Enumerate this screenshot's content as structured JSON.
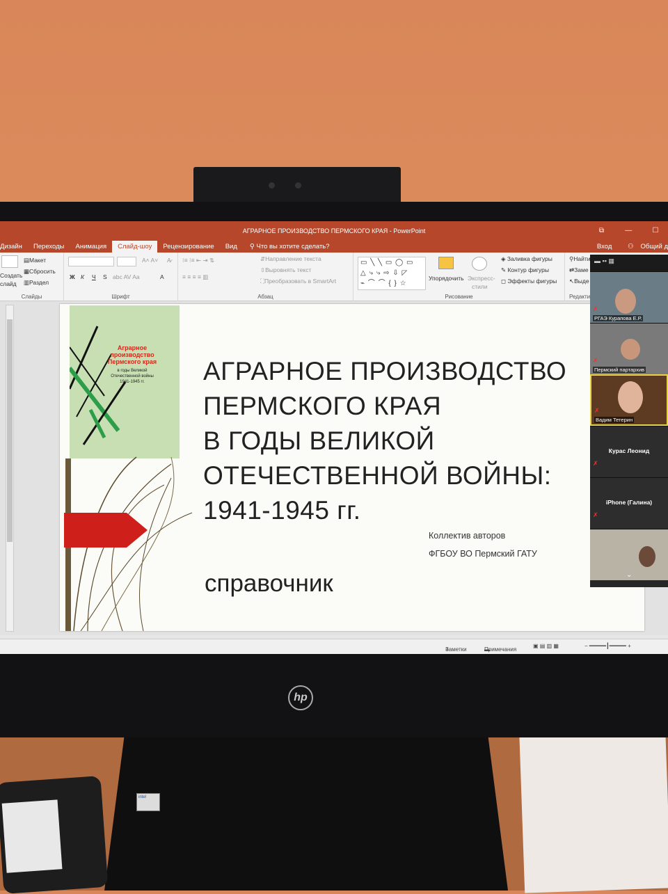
{
  "window": {
    "title": "АГРАРНОЕ ПРОИЗВОДСТВО ПЕРМСКОГО КРАЯ - PowerPoint",
    "controls": [
      "⧉",
      "—",
      "☐"
    ]
  },
  "ribbon_tabs": [
    "Дизайн",
    "Переходы",
    "Анимация",
    "Слайд-шоу",
    "Рецензирование",
    "Вид"
  ],
  "active_tab": "Слайд-шоу",
  "tell_me": "Что вы хотите сделать?",
  "account": {
    "login": "Вход",
    "share": "Общий д"
  },
  "ribbon": {
    "slides": {
      "create": "Создать",
      "create2": "слайд",
      "layout": "Макет",
      "reset": "Сбросить",
      "section": "Раздел",
      "group": "Слайды"
    },
    "font": {
      "bold": "Ж",
      "italic": "К",
      "underline": "Ч",
      "strike": "S",
      "group": "Шрифт"
    },
    "paragraph": {
      "text_dir": "Направление текста",
      "align_text": "Выровнять текст",
      "smartart": "Преобразовать в SmartArt",
      "group": "Абзац"
    },
    "drawing": {
      "arrange": "Упорядочить",
      "styles1": "Экспресс-",
      "styles2": "стили",
      "fill": "Заливка фигуры",
      "outline": "Контур фигуры",
      "effects": "Эффекты фигуры",
      "group": "Рисование"
    },
    "editing": {
      "find": "Найти",
      "replace": "Заме",
      "select": "Выде",
      "group": "Редакти"
    }
  },
  "slide": {
    "cover_title": "Аграрное производство Пермского края",
    "cover_sub": "в годы Великой Отечественной войны 1941-1945 гг.",
    "title_lines": [
      "АГРАРНОЕ ПРОИЗВОДСТВО",
      "ПЕРМСКОГО КРАЯ",
      "В ГОДЫ ВЕЛИКОЙ",
      "ОТЕЧЕСТВЕННОЙ ВОЙНЫ:",
      "1941-1945 гг."
    ],
    "authors": "Коллектив авторов",
    "org": "ФГБОУ ВО Пермский ГАТУ",
    "type": "справочник"
  },
  "statusbar": {
    "notes": "Заметки",
    "comments": "Примечания"
  },
  "video_call": {
    "participants": [
      {
        "name": "РГАЭ Курапова Е.Р."
      },
      {
        "name": "Пермский партархив"
      },
      {
        "name": "Вадим Тетерин"
      },
      {
        "name": "Курас Леонид"
      },
      {
        "name": "iPhone (Галина)"
      }
    ]
  },
  "colors": {
    "ppt_accent": "#b7472a",
    "slide_arrow": "#cf1f1a",
    "cover_green": "#c8dfb3"
  },
  "hardware": {
    "monitor_brand": "hp",
    "cpu_sticker": "intel"
  }
}
